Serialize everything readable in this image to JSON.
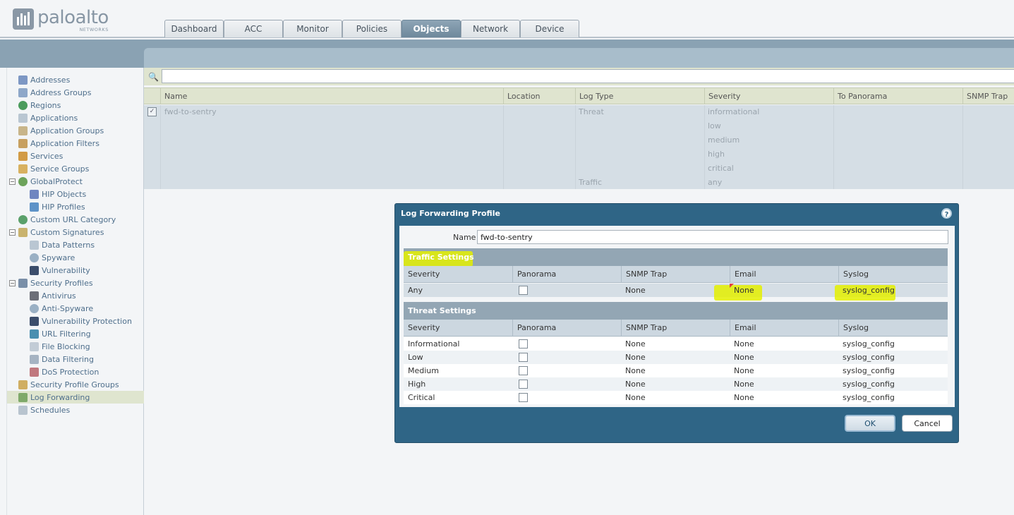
{
  "brand": {
    "name": "paloalto",
    "sub": "NETWORKS"
  },
  "tabs": [
    "Dashboard",
    "ACC",
    "Monitor",
    "Policies",
    "Objects",
    "Network",
    "Device"
  ],
  "active_tab": "Objects",
  "sidebar": {
    "items": [
      {
        "label": "Addresses"
      },
      {
        "label": "Address Groups"
      },
      {
        "label": "Regions"
      },
      {
        "label": "Applications"
      },
      {
        "label": "Application Groups"
      },
      {
        "label": "Application Filters"
      },
      {
        "label": "Services"
      },
      {
        "label": "Service Groups"
      },
      {
        "label": "GlobalProtect"
      },
      {
        "label": "HIP Objects"
      },
      {
        "label": "HIP Profiles"
      },
      {
        "label": "Custom URL Category"
      },
      {
        "label": "Custom Signatures"
      },
      {
        "label": "Data Patterns"
      },
      {
        "label": "Spyware"
      },
      {
        "label": "Vulnerability"
      },
      {
        "label": "Security Profiles"
      },
      {
        "label": "Antivirus"
      },
      {
        "label": "Anti-Spyware"
      },
      {
        "label": "Vulnerability Protection"
      },
      {
        "label": "URL Filtering"
      },
      {
        "label": "File Blocking"
      },
      {
        "label": "Data Filtering"
      },
      {
        "label": "DoS Protection"
      },
      {
        "label": "Security Profile Groups"
      },
      {
        "label": "Log Forwarding"
      },
      {
        "label": "Schedules"
      }
    ]
  },
  "grid": {
    "columns": [
      "Name",
      "Location",
      "Log Type",
      "Severity",
      "To Panorama",
      "SNMP Trap"
    ],
    "name": "fwd-to-sentry",
    "log_types": [
      "Threat",
      "Traffic"
    ],
    "severities": [
      "informational",
      "low",
      "medium",
      "high",
      "critical",
      "any"
    ]
  },
  "dialog": {
    "title": "Log Forwarding Profile",
    "name_label": "Name",
    "name_value": "fwd-to-sentry",
    "traffic": {
      "title": "Traffic Settings",
      "columns": [
        "Severity",
        "Panorama",
        "SNMP Trap",
        "Email",
        "Syslog"
      ],
      "rows": [
        {
          "severity": "Any",
          "snmp": "None",
          "email": "None",
          "syslog": "syslog_config"
        }
      ]
    },
    "threat": {
      "title": "Threat Settings",
      "columns": [
        "Severity",
        "Panorama",
        "SNMP Trap",
        "Email",
        "Syslog"
      ],
      "rows": [
        {
          "severity": "Informational",
          "snmp": "None",
          "email": "None",
          "syslog": "syslog_config"
        },
        {
          "severity": "Low",
          "snmp": "None",
          "email": "None",
          "syslog": "syslog_config"
        },
        {
          "severity": "Medium",
          "snmp": "None",
          "email": "None",
          "syslog": "syslog_config"
        },
        {
          "severity": "High",
          "snmp": "None",
          "email": "None",
          "syslog": "syslog_config"
        },
        {
          "severity": "Critical",
          "snmp": "None",
          "email": "None",
          "syslog": "syslog_config"
        }
      ]
    },
    "ok_label": "OK",
    "cancel_label": "Cancel",
    "help_glyph": "?"
  },
  "colors": {
    "dialog": "#2f6586",
    "highlight": "#e4f000",
    "band": "#8aa2b3"
  }
}
